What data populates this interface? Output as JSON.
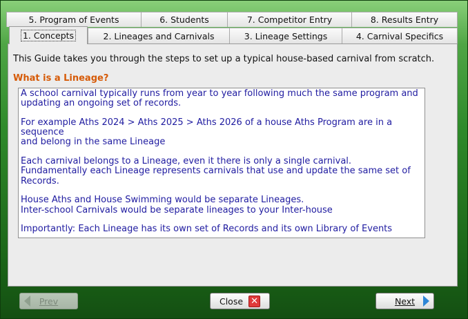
{
  "tabs": {
    "back_row": [
      "5. Program of Events",
      "6. Students",
      "7. Competitor Entry",
      "8. Results Entry"
    ],
    "front_row": [
      "1. Concepts",
      "2. Lineages and Carnivals",
      "3. Lineage Settings",
      "4. Carnival Specifics"
    ],
    "active": "1. Concepts"
  },
  "content": {
    "intro": "This Guide takes you through the steps to set up a typical house-based carnival from scratch.",
    "heading": "What is a Lineage?",
    "paragraphs": [
      [
        "A school carnival typically runs from year to year following much the same program and",
        "updating an ongoing set of records."
      ],
      [
        "For example Aths 2024 > Aths 2025 > Aths 2026 of a house Aths Program are in a sequence",
        "and belong in the same Lineage"
      ],
      [
        "Each carnival belongs to a Lineage, even it there is only a single carnival.",
        "Fundamentally each Lineage represents carnivals that use and update the same set of",
        "Records."
      ],
      [
        "House Aths and House Swimming would be separate Lineages.",
        "Inter-school Carnivals would be separate lineages to your Inter-house"
      ],
      [
        "Importantly: Each Lineage has its own set of Records and its own Library of Events"
      ]
    ]
  },
  "buttons": {
    "prev": "Prev",
    "close": "Close",
    "next": "Next"
  },
  "icons": {
    "prev": "arrow-left-icon",
    "close": "close-x-icon",
    "next": "arrow-right-icon"
  },
  "colors": {
    "heading": "#d65a07",
    "body_text": "#1f1ba0",
    "background": "#2f8a2b"
  }
}
